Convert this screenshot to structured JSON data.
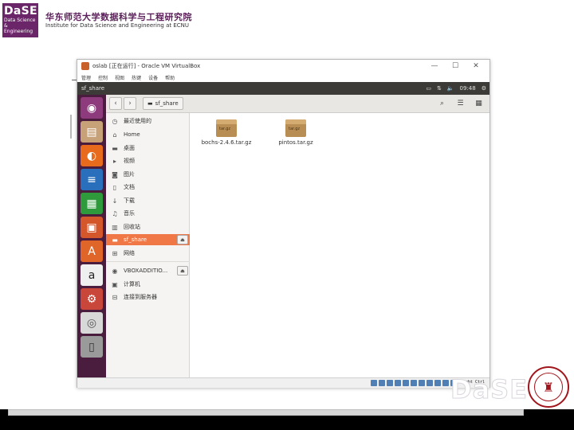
{
  "header": {
    "logo_big": "DaSE",
    "logo_small_1": "Data Science",
    "logo_small_2": "& Engineering",
    "institute_cn": "华东师范大学数据科学与工程研究院",
    "institute_en": "Institute for Data Science and Engineering at ECNU"
  },
  "vm_window": {
    "title": "oslab [正在运行] - Oracle VM VirtualBox",
    "controls": [
      "—",
      "☐",
      "✕"
    ],
    "menu": [
      "管理",
      "控制",
      "视图",
      "热键",
      "设备",
      "帮助"
    ],
    "panel_title": "sf_share",
    "panel_time": "09:48"
  },
  "nautilus": {
    "path_label": "sf_share",
    "sidebar": [
      {
        "icon": "clock",
        "label": "最近使用的"
      },
      {
        "icon": "home",
        "label": "Home"
      },
      {
        "icon": "folder",
        "label": "桌面"
      },
      {
        "icon": "video",
        "label": "视频"
      },
      {
        "icon": "camera",
        "label": "图片"
      },
      {
        "icon": "document",
        "label": "文档"
      },
      {
        "icon": "download",
        "label": "下载"
      },
      {
        "icon": "music",
        "label": "音乐"
      },
      {
        "icon": "trash",
        "label": "回收站"
      },
      {
        "icon": "drive",
        "label": "sf_share",
        "selected": true,
        "eject": true
      },
      {
        "icon": "network",
        "label": "网络"
      },
      {
        "icon": "disc",
        "label": "VBOXADDITIO...",
        "eject": true
      },
      {
        "icon": "computer",
        "label": "计算机"
      },
      {
        "icon": "server",
        "label": "连接到服务器"
      }
    ],
    "files": [
      {
        "name": "bochs-2.4.6.tar.gz",
        "badge": "tar.gz"
      },
      {
        "name": "pintos.tar.gz",
        "badge": "tar.gz"
      }
    ]
  },
  "statusbar": {
    "host_key": "Right Ctrl"
  },
  "branding": {
    "watermark": "DaSE"
  },
  "colors": {
    "accent": "#f07746",
    "launcher": "#4a1d3e",
    "panel": "#3c3b37",
    "brand_purple": "#6b2569"
  }
}
